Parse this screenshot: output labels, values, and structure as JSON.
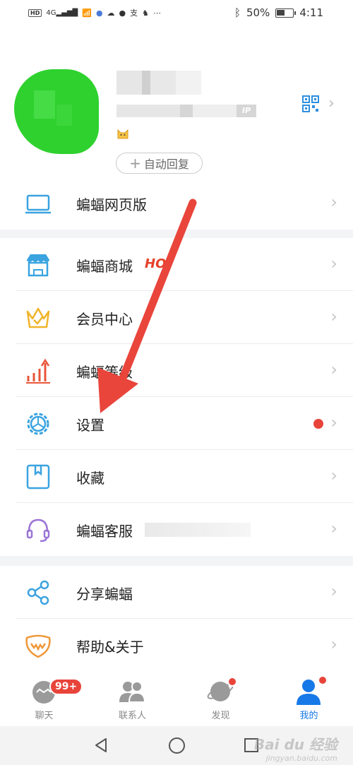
{
  "status_bar": {
    "left_icons": [
      "HD",
      "4G signal",
      "wifi",
      "music",
      "cloud",
      "chat",
      "zhi",
      "qq",
      "more"
    ],
    "hd_label": "HD",
    "network": "4G",
    "battery_text": "50%",
    "time": "4:11"
  },
  "profile": {
    "vip_label": "IP",
    "auto_reply_label": "自动回复",
    "auto_reply_prefix": "+"
  },
  "menu_sections": [
    [
      {
        "label": "蝙蝠网页版",
        "icon": "laptop-icon"
      }
    ],
    [
      {
        "label": "蝙蝠商城",
        "icon": "store-icon",
        "tag": "HO"
      },
      {
        "label": "会员中心",
        "icon": "crown-icon"
      },
      {
        "label": "蝙蝠等级",
        "icon": "level-chart-icon"
      },
      {
        "label": "设置",
        "icon": "settings-gear-icon",
        "has_red_dot": true
      },
      {
        "label": "收藏",
        "icon": "bookmark-icon"
      },
      {
        "label": "蝙蝠客服",
        "icon": "headset-icon",
        "suffix": "（"
      }
    ],
    [
      {
        "label": "分享蝙蝠",
        "icon": "share-icon"
      },
      {
        "label": "帮助&关于",
        "icon": "help-bat-icon"
      }
    ]
  ],
  "tabs": [
    {
      "label": "聊天",
      "badge": "99+",
      "icon": "chat-bat-icon"
    },
    {
      "label": "联系人",
      "icon": "contacts-icon"
    },
    {
      "label": "发现",
      "icon": "planet-icon",
      "has_dot": true
    },
    {
      "label": "我的",
      "icon": "user-icon",
      "active": true,
      "has_dot": true
    }
  ],
  "watermark": {
    "text": "Bai du 经验",
    "sub": "jingyan.baidu.com"
  },
  "colors": {
    "accent": "#1779e8",
    "red": "#e8443a",
    "icon_blue": "#3aa3e0",
    "arrow": "#e9453b"
  }
}
